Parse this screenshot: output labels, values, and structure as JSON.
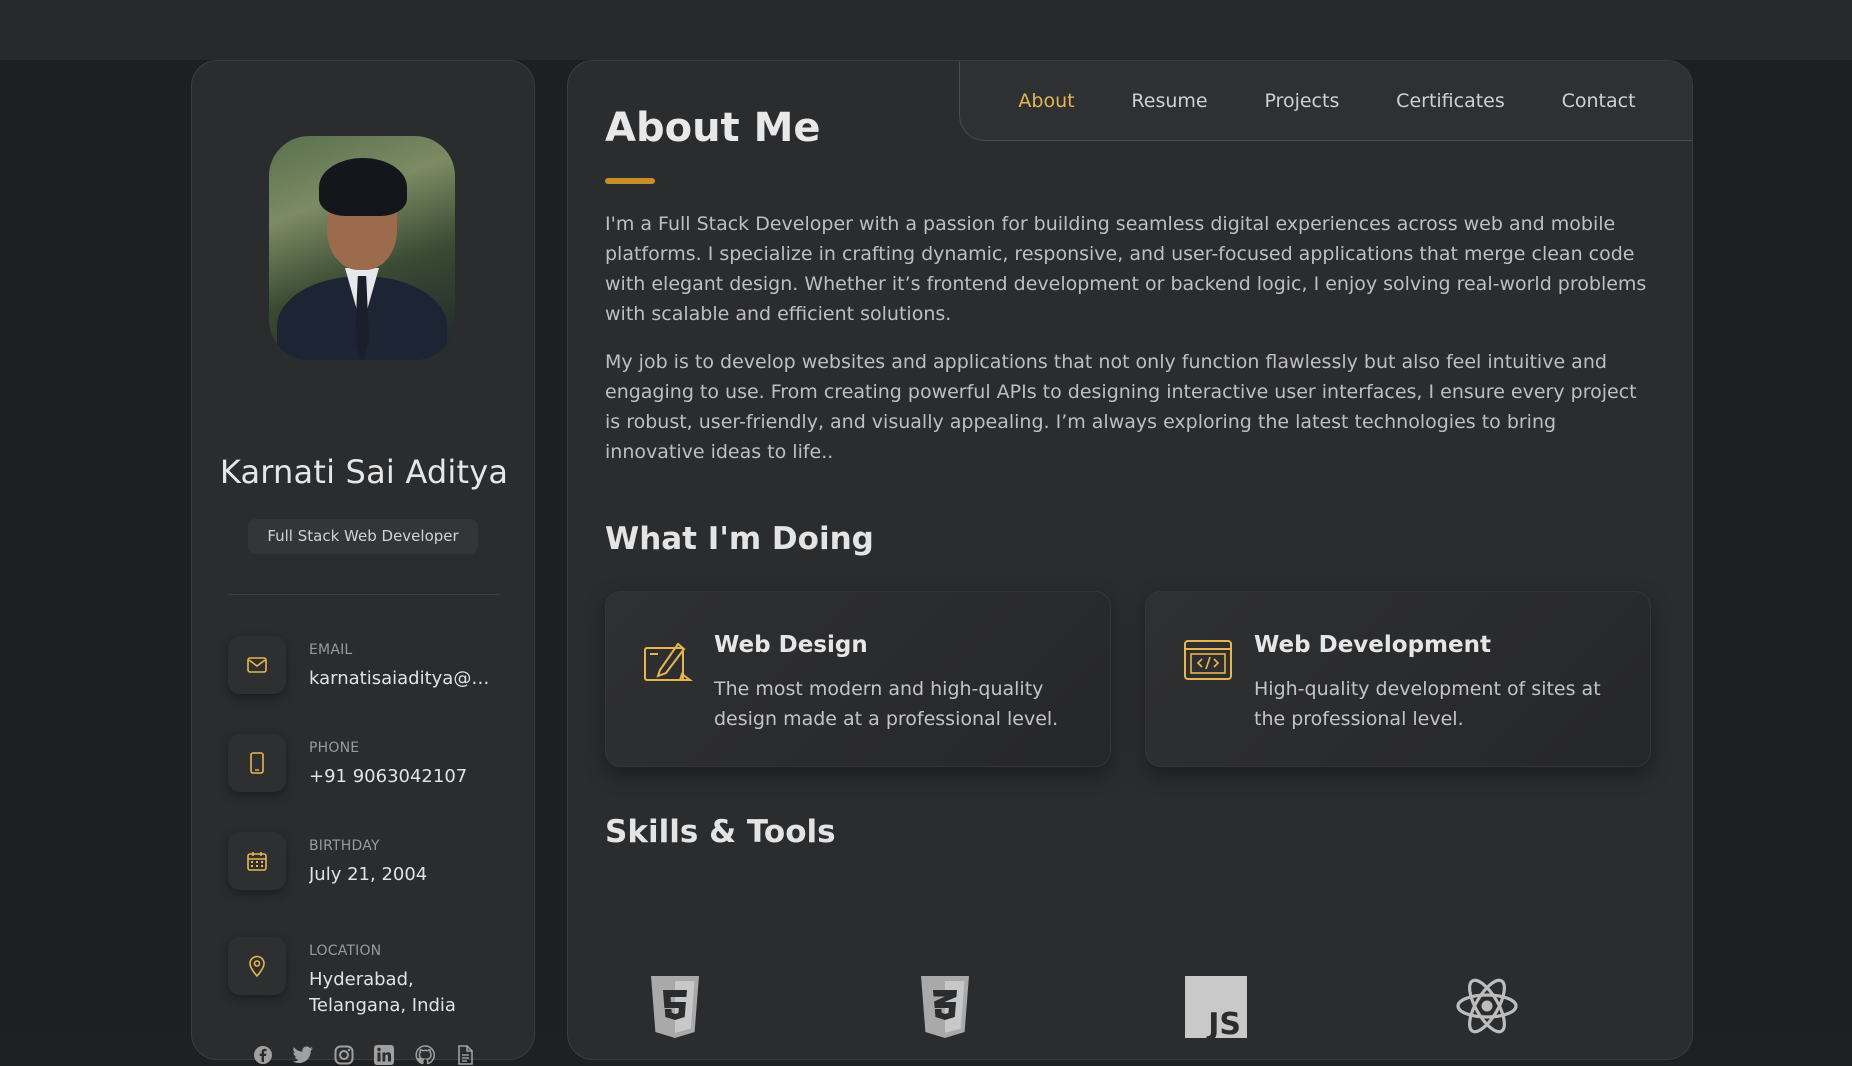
{
  "profile": {
    "name": "Karnati Sai Aditya",
    "role": "Full Stack Web Developer"
  },
  "contacts": [
    {
      "label": "EMAIL",
      "value": "karnatisaiaditya@g...",
      "icon": "mail-icon"
    },
    {
      "label": "PHONE",
      "value": "+91 9063042107",
      "icon": "phone-icon"
    },
    {
      "label": "BIRTHDAY",
      "value": "July 21, 2004",
      "icon": "calendar-icon"
    },
    {
      "label": "LOCATION",
      "value": "Hyderabad, Telangana, India",
      "icon": "location-pin-icon"
    }
  ],
  "socials": [
    "facebook-icon",
    "twitter-icon",
    "instagram-icon",
    "linkedin-icon",
    "github-icon",
    "document-icon"
  ],
  "nav": {
    "items": [
      "About",
      "Resume",
      "Projects",
      "Certificates",
      "Contact"
    ],
    "active": "About"
  },
  "about": {
    "title": "About Me",
    "p1": "I'm a Full Stack Developer with a passion for building seamless digital experiences across web and mobile platforms. I specialize in crafting dynamic, responsive, and user-focused applications that merge clean code with elegant design. Whether it’s frontend development or backend logic, I enjoy solving real-world problems with scalable and efficient solutions.",
    "p2": "My job is to develop websites and applications that not only function flawlessly but also feel intuitive and engaging to use. From creating powerful APIs to designing interactive user interfaces, I ensure every project is robust, user-friendly, and visually appealing. I’m always exploring the latest technologies to bring innovative ideas to life.."
  },
  "doing": {
    "title": "What I'm Doing",
    "services": [
      {
        "title": "Web Design",
        "text": "The most modern and high-quality design made at a professional level.",
        "icon": "web-design-icon"
      },
      {
        "title": "Web Development",
        "text": "High-quality development of sites at the professional level.",
        "icon": "web-development-icon"
      }
    ]
  },
  "skills": {
    "title": "Skills & Tools",
    "items": [
      "html5-icon",
      "css3-icon",
      "javascript-icon",
      "react-icon"
    ]
  },
  "colors": {
    "accent": "#e7b54f",
    "underline": "#c98e2a",
    "background": "#1e1f20",
    "card": "#2b2c2e"
  }
}
